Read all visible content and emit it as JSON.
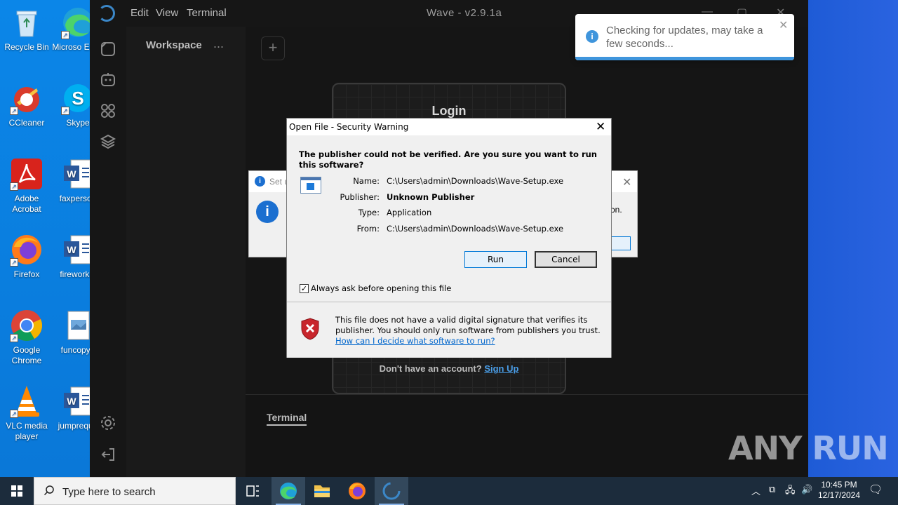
{
  "desktop": {
    "icons_left": [
      {
        "label": "Recycle Bin"
      },
      {
        "label": "CCleaner"
      },
      {
        "label": "Adobe Acrobat"
      },
      {
        "label": "Firefox"
      },
      {
        "label": "Google Chrome"
      },
      {
        "label": "VLC media player"
      }
    ],
    "icons_right": [
      {
        "label": "Microso Edge"
      },
      {
        "label": "Skype"
      },
      {
        "label": "faxperson"
      },
      {
        "label": "fireworkin"
      },
      {
        "label": "funcopyri"
      },
      {
        "label": "jumpreque"
      }
    ]
  },
  "wave": {
    "menu": [
      "Edit",
      "View",
      "Terminal"
    ],
    "title": "Wave - v2.9.1a",
    "workspace_title": "Workspace",
    "workspace_menu": "...",
    "login_title": "Login",
    "login_footer_text": "Don't have an account?",
    "login_signup_link": "Sign Up",
    "terminal_label": "Terminal"
  },
  "bg_dialog": {
    "title_partial": "Set u",
    "message_partial": "on."
  },
  "security_warning": {
    "title": "Open File - Security Warning",
    "heading": "The publisher could not be verified.  Are you sure you want to run this software?",
    "fields": [
      {
        "key": "Name:",
        "value": "C:\\Users\\admin\\Downloads\\Wave-Setup.exe"
      },
      {
        "key": "Publisher:",
        "value": "Unknown Publisher"
      },
      {
        "key": "Type:",
        "value": "Application"
      },
      {
        "key": "From:",
        "value": "C:\\Users\\admin\\Downloads\\Wave-Setup.exe"
      }
    ],
    "run_label": "Run",
    "cancel_label": "Cancel",
    "checkbox_label": "Always ask before opening this file",
    "checkbox_checked": true,
    "note": "This file does not have a valid digital signature that verifies its publisher.  You should only run software from publishers you trust.",
    "link": "How can I decide what software to run?"
  },
  "toast": {
    "message": "Checking for updates, may take a few seconds..."
  },
  "watermark": "ANY RUN",
  "taskbar": {
    "search_placeholder": "Type here to search",
    "time": "10:45 PM",
    "date": "12/17/2024"
  },
  "colors": {
    "desktop_bg": "#0a7ee0",
    "wave_bg": "#141414",
    "accent": "#0078d7",
    "toast_accent": "#3f95dc"
  }
}
